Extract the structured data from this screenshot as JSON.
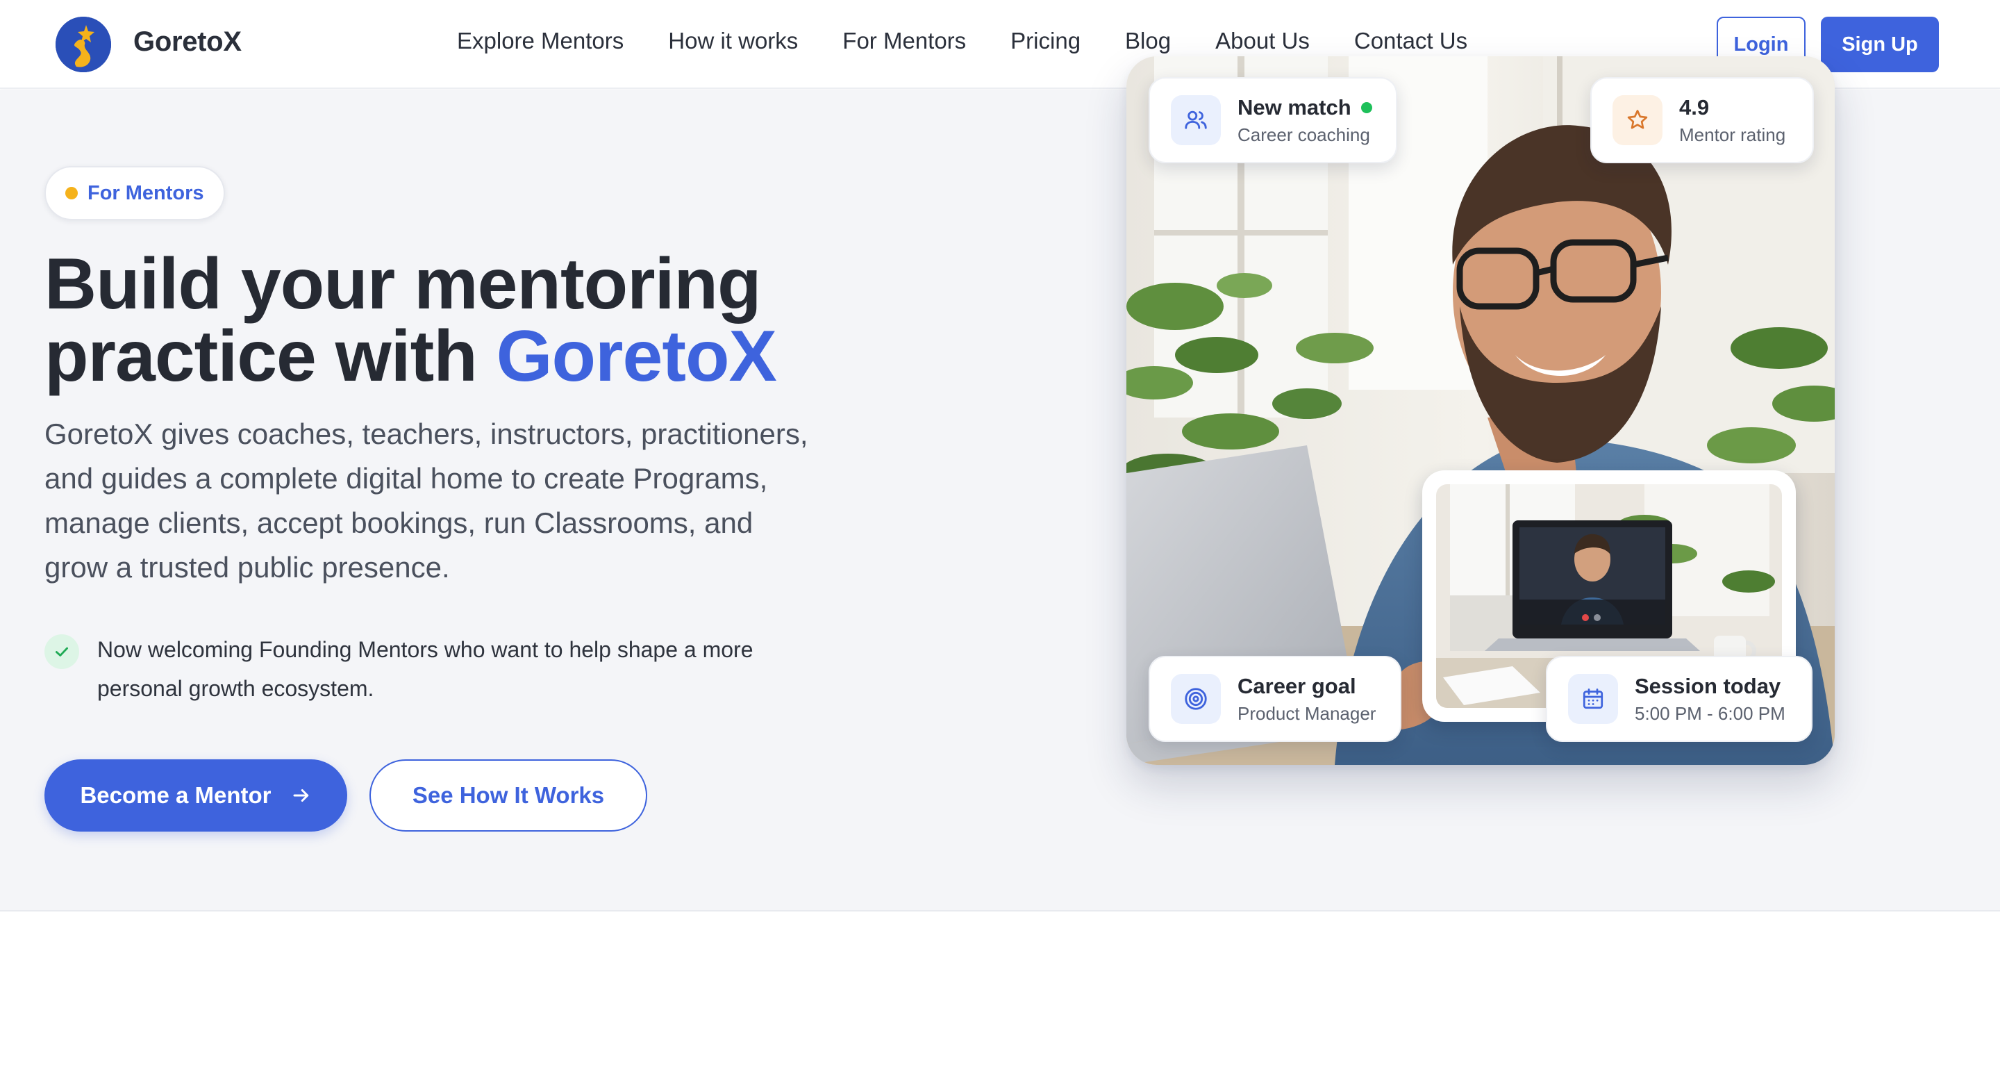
{
  "header": {
    "brand": "GoretoX",
    "nav": [
      {
        "label": "Explore Mentors"
      },
      {
        "label": "How it works"
      },
      {
        "label": "For Mentors"
      },
      {
        "label": "Pricing"
      },
      {
        "label": "Blog"
      },
      {
        "label": "About Us"
      },
      {
        "label": "Contact Us"
      }
    ],
    "login_label": "Login",
    "signup_label": "Sign Up"
  },
  "hero": {
    "badge": "For Mentors",
    "headline_line1": "Build your mentoring",
    "headline_line2_prefix": "practice with ",
    "headline_accent": "GoretoX",
    "subtext": "GoretoX gives coaches, teachers, instructors, practitioners, and guides a complete digital home to create Programs, manage clients, accept bookings, run Classrooms, and grow a trusted public presence.",
    "notice": "Now welcoming Founding Mentors who want to help shape a more personal growth ecosystem.",
    "primary_cta": "Become a Mentor",
    "secondary_cta": "See How It Works"
  },
  "cards": {
    "match": {
      "title": "New match",
      "subtitle": "Career coaching",
      "icon": "users-icon"
    },
    "rating": {
      "title": "4.9",
      "subtitle": "Mentor rating",
      "icon": "star-icon"
    },
    "goal": {
      "title": "Career goal",
      "subtitle": "Product Manager",
      "icon": "target-icon"
    },
    "session": {
      "title": "Session today",
      "subtitle": "5:00 PM - 6:00 PM",
      "icon": "calendar-icon"
    }
  },
  "colors": {
    "accent": "#3e63dd",
    "hero_bg": "#f4f5f8",
    "badge_dot": "#f5b21b",
    "status_online": "#1ec05a"
  }
}
